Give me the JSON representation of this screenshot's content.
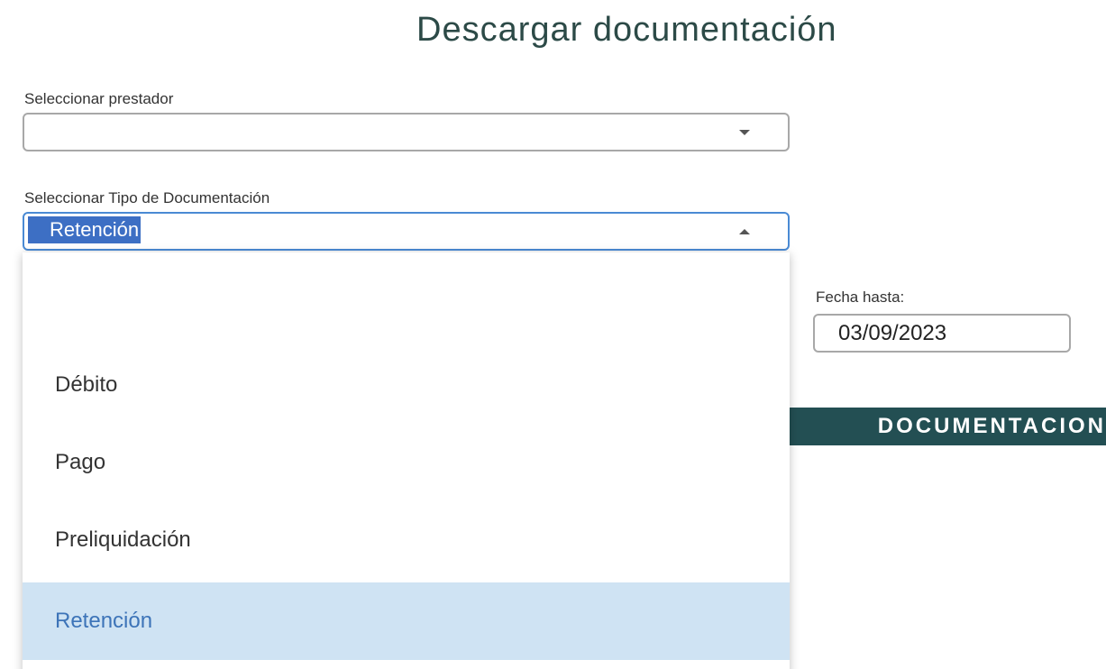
{
  "page": {
    "title": "Descargar documentación"
  },
  "prestador": {
    "label": "Seleccionar prestador",
    "value": ""
  },
  "tipo_documentacion": {
    "label": "Seleccionar Tipo de Documentación",
    "value": "Retención",
    "options": [
      "",
      "Débito",
      "Pago",
      "Preliquidación",
      "Retención"
    ],
    "selected_index": 4
  },
  "fecha_hasta": {
    "label": "Fecha hasta:",
    "value": "03/09/2023"
  },
  "download_button": {
    "label": "DESCARGAR DOCUMENTACION",
    "visible_label": "DOCUMENTACION"
  },
  "colors": {
    "title": "#2c4a47",
    "button_bg": "#234f53",
    "selection_highlight": "#3d6fc4",
    "option_selected_bg": "#cfe3f3",
    "option_selected_text": "#3d74b8",
    "focus_border": "#4a8ad4"
  },
  "icons": {
    "prestador_caret": "chevron-down-icon",
    "tipo_caret": "chevron-up-icon"
  }
}
